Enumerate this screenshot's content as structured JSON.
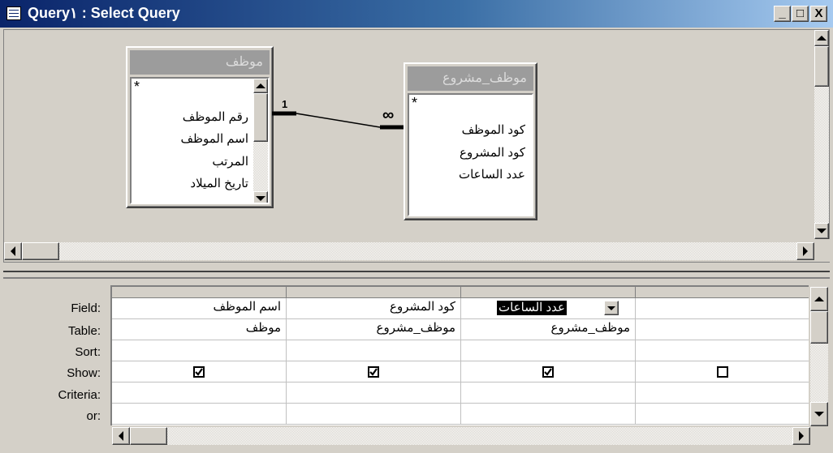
{
  "window": {
    "title": "Query١ : Select Query",
    "min_label": "_",
    "max_label": "□",
    "close_label": "X"
  },
  "tables": [
    {
      "name": "موظف",
      "fields": [
        "*",
        "رقم الموظف",
        "اسم الموظف",
        "المرتب",
        "تاريخ الميلاد"
      ]
    },
    {
      "name": "موظف_مشروع",
      "fields": [
        "*",
        "كود الموظف",
        "كود المشروع",
        "عدد الساعات"
      ]
    }
  ],
  "relationship": {
    "one_label": "1",
    "many_label": "∞"
  },
  "grid": {
    "row_labels": [
      "Field:",
      "Table:",
      "Sort:",
      "Show:",
      "Criteria:",
      "or:"
    ],
    "columns": [
      {
        "field": "اسم الموظف",
        "table": "موظف",
        "sort": "",
        "show": true,
        "criteria": "",
        "or": ""
      },
      {
        "field": "كود المشروع",
        "table": "موظف_مشروع",
        "sort": "",
        "show": true,
        "criteria": "",
        "or": ""
      },
      {
        "field": "عدد الساعات",
        "table": "موظف_مشروع",
        "sort": "",
        "show": true,
        "criteria": "",
        "or": "",
        "selected": true
      },
      {
        "field": "",
        "table": "",
        "sort": "",
        "show": false,
        "criteria": "",
        "or": ""
      }
    ]
  },
  "colors": {
    "title_start": "#0a246a",
    "title_end": "#a6caf0",
    "face": "#d4d0c8",
    "selection": "#000000"
  }
}
